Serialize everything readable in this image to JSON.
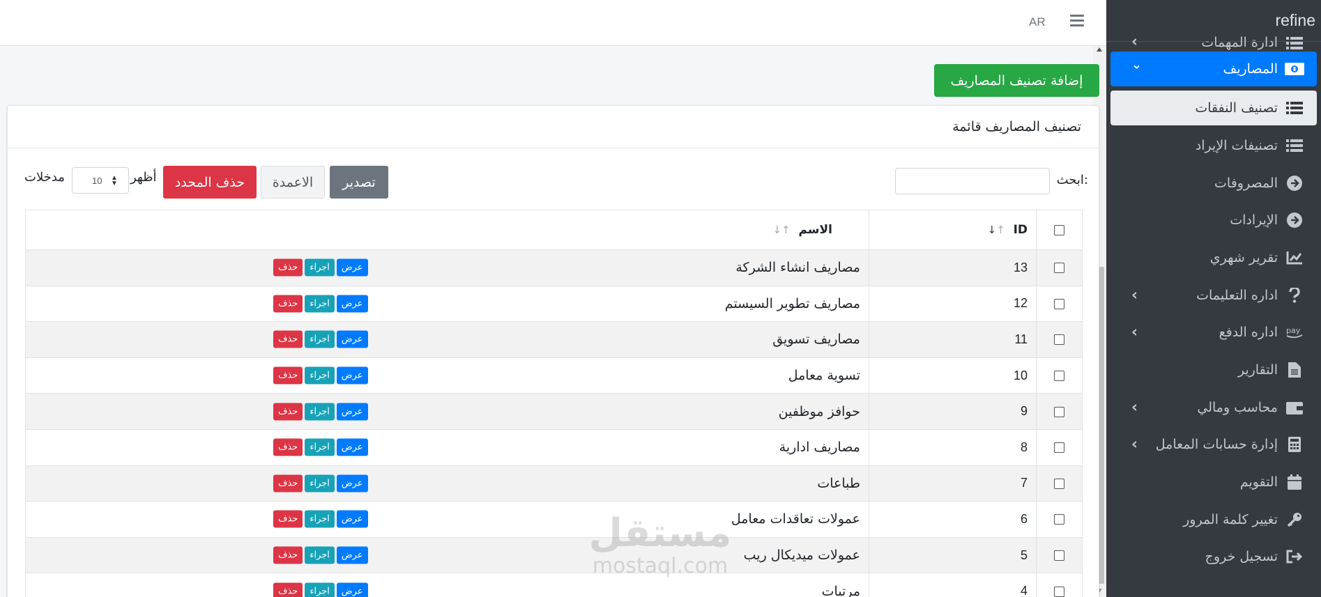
{
  "brand": "refine",
  "topbar": {
    "lang": "AR"
  },
  "sidebar": {
    "items": [
      {
        "label": "ادارة المهمات",
        "icon": "list-icon",
        "chevron": "‹"
      },
      {
        "label": "المصاريف",
        "icon": "money-bill-icon",
        "chevron": "⌄",
        "state": "active"
      },
      {
        "label": "تصنيف النفقات",
        "icon": "list-icon",
        "state": "sub-active"
      },
      {
        "label": "تصنيفات الإيراد",
        "icon": "list-icon"
      },
      {
        "label": "المصروفات",
        "icon": "arrow-circle-icon"
      },
      {
        "label": "الإيرادات",
        "icon": "arrow-circle-icon"
      },
      {
        "label": "تقرير شهري",
        "icon": "chart-line-icon"
      },
      {
        "label": "اداره التعليمات",
        "icon": "question-icon",
        "chevron": "‹"
      },
      {
        "label": "اداره الدفع",
        "icon": "amazon-pay-icon",
        "chevron": "‹"
      },
      {
        "label": "التقارير",
        "icon": "file-icon"
      },
      {
        "label": "محاسب ومالي",
        "icon": "wallet-icon",
        "chevron": "‹"
      },
      {
        "label": "إدارة حسابات المعامل",
        "icon": "calculator-icon",
        "chevron": "‹"
      },
      {
        "label": "التقويم",
        "icon": "calendar-icon"
      },
      {
        "label": "تغيير كلمة المرور",
        "icon": "key-icon"
      },
      {
        "label": "تسجيل خروج",
        "icon": "sign-out-icon"
      }
    ]
  },
  "main": {
    "add_button": "إضافة تصنيف المصاريف",
    "card_title": "تصنيف المصاريف قائمة",
    "search_label": "ابحث:",
    "export_button": "تصدير",
    "columns_button": "الاعمدة",
    "delete_selected_button": "حذف المحدد",
    "show_label": "أظهر",
    "length_value": "10",
    "entries_label": "مدخلات"
  },
  "table": {
    "headers": {
      "id": "ID",
      "name": "الاسم"
    },
    "action_labels": {
      "view": "عرض",
      "process": "اجراء",
      "delete": "حذف"
    },
    "rows": [
      {
        "id": "13",
        "name": "مصاريف انشاء الشركة"
      },
      {
        "id": "12",
        "name": "مصاريف تطوير السيستم"
      },
      {
        "id": "11",
        "name": "مصاريف تسويق"
      },
      {
        "id": "10",
        "name": "تسوية معامل"
      },
      {
        "id": "9",
        "name": "حوافز موظفين"
      },
      {
        "id": "8",
        "name": "مصاريف ادارية"
      },
      {
        "id": "7",
        "name": "طباعات"
      },
      {
        "id": "6",
        "name": "عمولات تعاقدات معامل"
      },
      {
        "id": "5",
        "name": "عمولات ميديكال ريب"
      },
      {
        "id": "4",
        "name": "مرتبات"
      }
    ]
  },
  "colors": {
    "sidebar_bg": "#343a40",
    "active": "#007bff",
    "success": "#28a745",
    "danger": "#dc3545",
    "info": "#17a2b8",
    "secondary": "#6c757d"
  },
  "watermark": {
    "arabic": "مستقل",
    "latin": "mostaql.com"
  }
}
